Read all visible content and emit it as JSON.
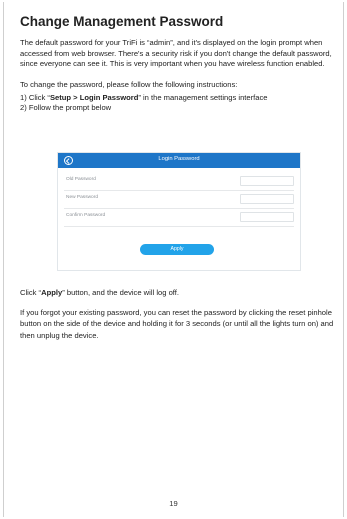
{
  "title": "Change Management Password",
  "intro": "The default password for your TriFi is “admin”, and it's displayed on the login prompt when accessed from web browser. There's a security risk if you don't change the default password, since everyone can see it. This is very important when you have wireless function enabled.",
  "instructions_heading": "To change the password, please follow the following instructions:",
  "step1": {
    "prefix": "1) Click “",
    "bold": "Setup > Login Password",
    "suffix": "” in the management settings interface"
  },
  "step2": "2) Follow the prompt below",
  "screenshot": {
    "header_title": "Login Password",
    "fields": [
      {
        "label": "Old Password"
      },
      {
        "label": "New Password"
      },
      {
        "label": "Confirm Password"
      }
    ],
    "apply_label": "Apply",
    "header_color": "#1e76c8",
    "button_color": "#22a3e9"
  },
  "click_apply": {
    "prefix": "Click “",
    "bold": "Apply",
    "suffix": "” button, and the device will log off."
  },
  "reset_note": "If you forgot your existing password, you can reset the password by clicking the reset pinhole button on the side of the device and holding it for 3 seconds (or until all the lights turn on) and then unplug the device.",
  "page_number": "19"
}
